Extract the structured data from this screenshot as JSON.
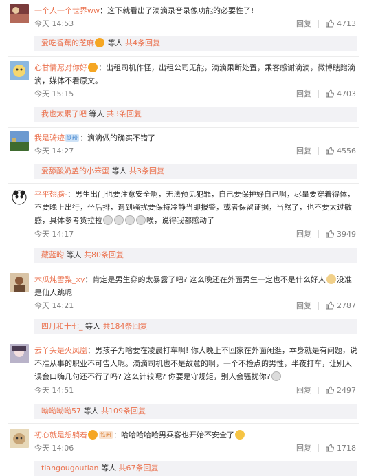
{
  "comments": [
    {
      "user": "一个人一个世界ww",
      "text": "：这下就看出了滴滴录音录像功能的必要性了!",
      "time": "今天 14:53",
      "reply": "回复",
      "likes": "4713",
      "sub_user": "爱吃香蕉的芝麻",
      "sub_text": " 等人 ",
      "sub_count": "共4条回复"
    },
    {
      "user": "心甘情愿对你好",
      "text": "：出租司机作怪，出租公司无能，滴滴果断处置，乘客感谢滴滴，微博瞎蹭滴滴，媒体不看原文。",
      "time": "今天 15:15",
      "reply": "回复",
      "likes": "4703",
      "sub_user": "我也太累了吧",
      "sub_text": " 等人 ",
      "sub_count": "共3条回复"
    },
    {
      "user": "我是骑迹",
      "badge": "铁粉",
      "text": "：滴滴做的确实不错了",
      "time": "今天 14:27",
      "reply": "回复",
      "likes": "4556",
      "sub_user": "爱舔酸奶盖的小笨蛋",
      "sub_text": " 等人 ",
      "sub_count": "共3条回复"
    },
    {
      "user": "平平翅膀-",
      "text_a": "：男生出门也要注意安全啊，无法预见犯罪，自己要保护好自己啊，尽量要穿着得体，不要晚上出行，坐后排，遇到骚扰要保持冷静当即报警，或者保留证据，当然了，也不要太过敏感，具体参考货拉拉",
      "text_b": "唉，说得我都感动了",
      "time": "今天 14:17",
      "reply": "回复",
      "likes": "3949",
      "sub_user": "藏蓝昀",
      "sub_text": " 等人 ",
      "sub_count": "共80条回复"
    },
    {
      "user": "木瓜炖雪梨_xy",
      "text_a": "：肯定是男生穿的太暴露了吧? 这么晚还在外面男生一定也不是什么好人",
      "text_b": "没准是仙人跳呢",
      "time": "今天 14:21",
      "reply": "回复",
      "likes": "2787",
      "sub_user": "四月和十七_",
      "sub_text": " 等人 ",
      "sub_count": "共184条回复"
    },
    {
      "user": "云丫头是火凤凰",
      "text_a": "：男孩子为啥要在凌晨打车啊! 你大晚上不回家在外面闲逛，本身就是有问题，说不准从事的职业不可告人呢。滴滴司机也不是故意的啊，一个不检点的男性，半夜打车，让别人误会口嗨几句还不行了吗? 这么计较呢? 你要是守规矩，别人会骚扰你?",
      "text_b": "",
      "time": "今天 14:51",
      "reply": "回复",
      "likes": "2497",
      "sub_user": "呦呦呦呦57",
      "sub_text": " 等人 ",
      "sub_count": "共109条回复"
    },
    {
      "user": "初心就是想躺着",
      "badge": "铁粉",
      "text_a": "：哈哈哈哈哈男乘客也开始不安全了",
      "text_b": "",
      "time": "今天 14:06",
      "reply": "回复",
      "likes": "1718",
      "sub_user": "tiangougoutian",
      "sub_text": " 等人 ",
      "sub_count": "共67条回复"
    }
  ]
}
